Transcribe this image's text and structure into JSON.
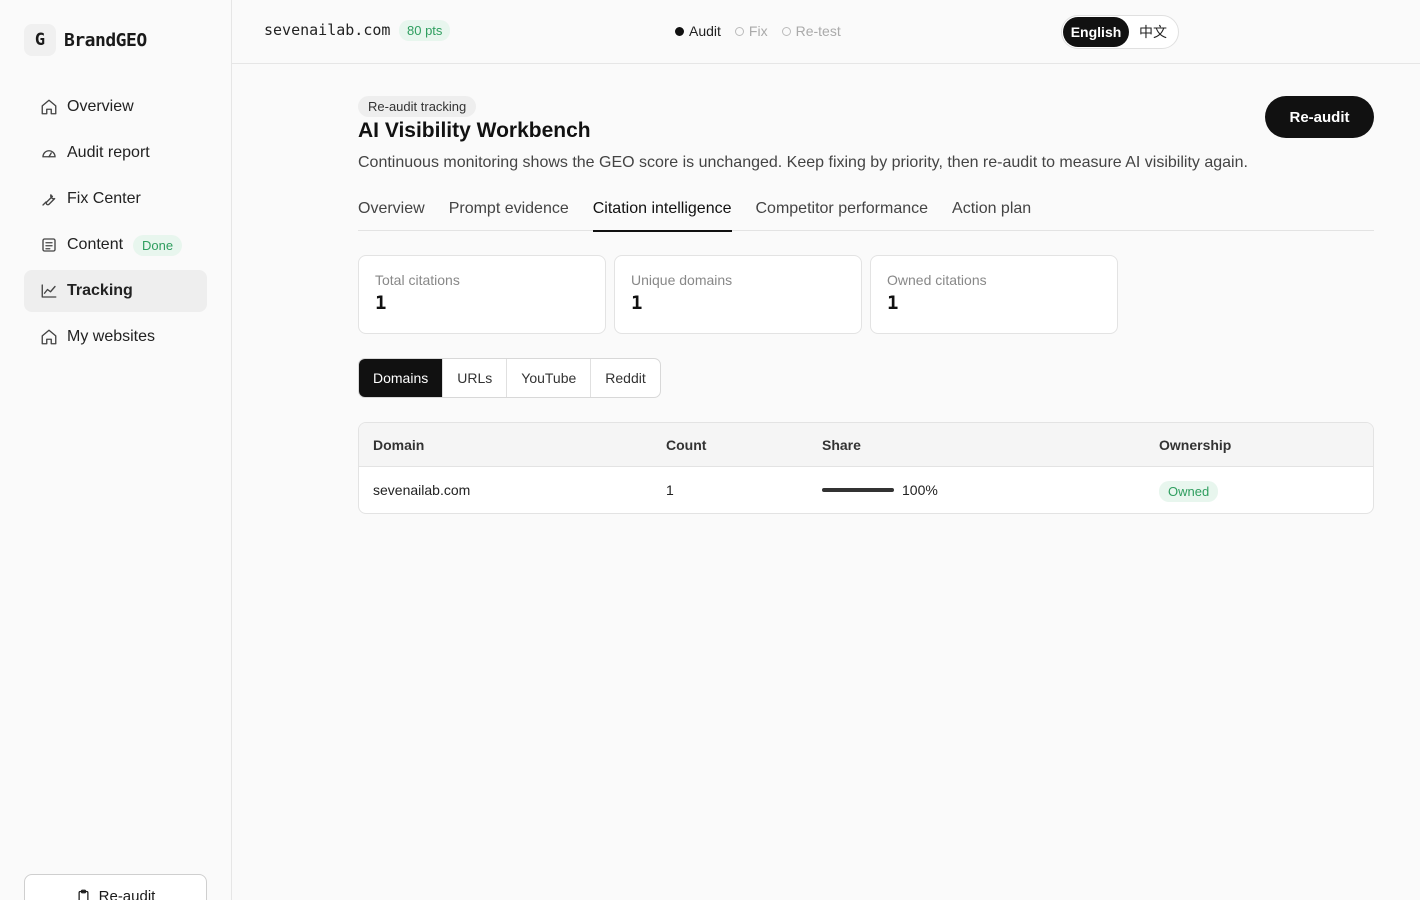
{
  "brand": {
    "logo_letter": "G",
    "name": "BrandGEO"
  },
  "sidebar": {
    "items": [
      {
        "label": "Overview",
        "icon": "home-icon"
      },
      {
        "label": "Audit report",
        "icon": "gauge-icon"
      },
      {
        "label": "Fix Center",
        "icon": "wrench-icon"
      },
      {
        "label": "Content",
        "icon": "document-icon",
        "badge": "Done"
      },
      {
        "label": "Tracking",
        "icon": "chart-line-icon",
        "active": true
      },
      {
        "label": "My websites",
        "icon": "home-icon"
      }
    ],
    "reaudit_label": "Re-audit"
  },
  "topbar": {
    "domain": "sevenailab.com",
    "points": "80 pts",
    "steps": [
      {
        "label": "Audit",
        "active": true
      },
      {
        "label": "Fix",
        "active": false
      },
      {
        "label": "Re-test",
        "active": false
      }
    ],
    "languages": {
      "english": "English",
      "chinese": "中文",
      "selected": "English"
    }
  },
  "header": {
    "pill": "Re-audit tracking",
    "title": "AI Visibility Workbench",
    "description": "Continuous monitoring shows the GEO score is unchanged. Keep fixing by priority, then re-audit to measure AI visibility again.",
    "reaudit_label": "Re-audit"
  },
  "tabs": [
    {
      "label": "Overview"
    },
    {
      "label": "Prompt evidence"
    },
    {
      "label": "Citation intelligence",
      "active": true
    },
    {
      "label": "Competitor performance"
    },
    {
      "label": "Action plan"
    }
  ],
  "stats": [
    {
      "label": "Total citations",
      "value": "1"
    },
    {
      "label": "Unique domains",
      "value": "1"
    },
    {
      "label": "Owned citations",
      "value": "1"
    }
  ],
  "segments": [
    {
      "label": "Domains",
      "active": true
    },
    {
      "label": "URLs"
    },
    {
      "label": "YouTube"
    },
    {
      "label": "Reddit"
    }
  ],
  "table": {
    "headers": {
      "domain": "Domain",
      "count": "Count",
      "share": "Share",
      "ownership": "Ownership"
    },
    "rows": [
      {
        "domain": "sevenailab.com",
        "count": "1",
        "share": "100%",
        "share_fraction": 1.0,
        "ownership": "Owned"
      }
    ]
  },
  "colors": {
    "accent": "#111111",
    "success": "#2f9e5f",
    "success_bg": "#e8f6ee"
  }
}
